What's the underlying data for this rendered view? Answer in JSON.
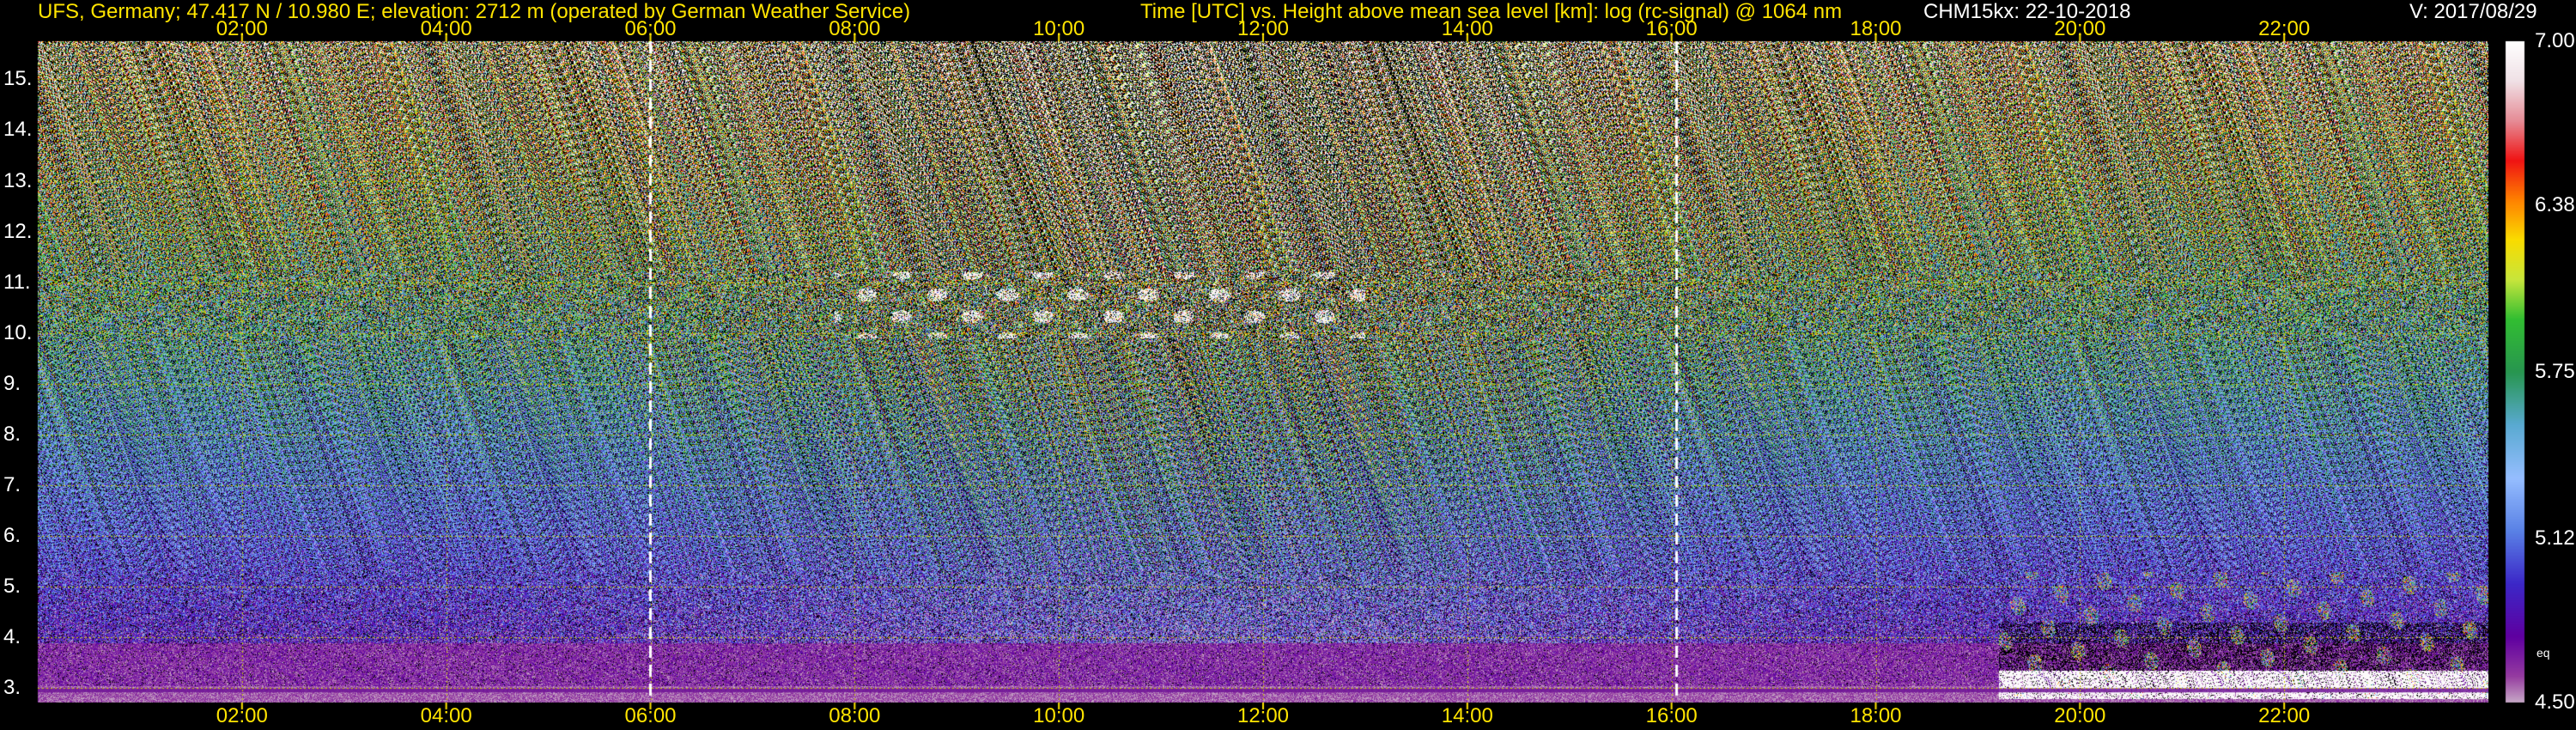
{
  "header": {
    "site": "UFS, Germany; 47.417 N / 10.980 E; elevation: 2712 m  (operated by German Weather Service)",
    "axes": "Time [UTC] vs. Height above mean sea level [km]: log (rc-signal) @ 1064 nm",
    "instrument": "CHM15kx: 22-10-2018",
    "version": "V: 2017/08/29"
  },
  "chart_data": {
    "type": "heatmap",
    "xlabel": "Time [UTC]",
    "ylabel": "Height above mean sea level [km]",
    "x_ticks": [
      "02:00",
      "04:00",
      "06:00",
      "08:00",
      "10:00",
      "12:00",
      "14:00",
      "16:00",
      "18:00",
      "20:00",
      "22:00"
    ],
    "x_tick_hours": [
      2,
      4,
      6,
      8,
      10,
      12,
      14,
      16,
      18,
      20,
      22
    ],
    "xlim_hours": [
      0,
      24
    ],
    "y_ticks": [
      "3.",
      "4.",
      "5.",
      "6.",
      "7.",
      "8.",
      "9.",
      "10.",
      "11.",
      "12.",
      "13.",
      "14.",
      "15."
    ],
    "y_tick_km": [
      3,
      4,
      5,
      6,
      7,
      8,
      9,
      10,
      11,
      12,
      13,
      14,
      15
    ],
    "ylim_km": [
      2.72,
      15.75
    ],
    "grid": true,
    "vertical_markers_hours": [
      6.0,
      16.05
    ],
    "colorbar": {
      "ticks": [
        "7.00",
        "6.38",
        "5.75",
        "5.12",
        "4.50"
      ],
      "values": [
        7.0,
        6.38,
        5.75,
        5.12,
        4.5
      ],
      "range": [
        4.5,
        7.0
      ],
      "unit": "eq"
    },
    "features": [
      {
        "kind": "cirrus",
        "t_start": 7.8,
        "t_end": 13.0,
        "h_low": 9.9,
        "h_high": 11.2
      },
      {
        "kind": "low_cloud",
        "t_start": 19.2,
        "t_end": 24.0,
        "h_low": 2.8,
        "h_high": 5.3
      }
    ],
    "colors": {
      "axis_text": "#ffe400",
      "grid": "#c8c800",
      "background": "#000000"
    }
  }
}
